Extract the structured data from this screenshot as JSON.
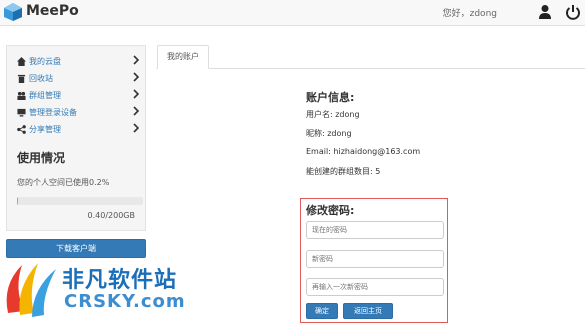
{
  "header": {
    "brand": "MeePo",
    "greeting": "您好，zdong"
  },
  "sidebar": {
    "items": [
      {
        "label": "我的云盘",
        "icon": "home-icon"
      },
      {
        "label": "回收站",
        "icon": "trash-icon"
      },
      {
        "label": "群组管理",
        "icon": "group-icon"
      },
      {
        "label": "管理登录设备",
        "icon": "monitor-icon"
      },
      {
        "label": "分享管理",
        "icon": "share-icon"
      }
    ],
    "usage": {
      "title": "使用情况",
      "text": "您的个人空间已使用0.2%",
      "percent": 0.2,
      "amount": "0.40/200GB"
    },
    "download_label": "下载客户端"
  },
  "main": {
    "tab_label": "我的账户",
    "account": {
      "title": "账户信息:",
      "username": "用户名: zdong",
      "nickname": "昵称: zdong",
      "email": "Email:  hizhaidong@163.com",
      "groups": "能创建的群组数目:  5"
    },
    "password": {
      "title": "修改密码:",
      "current_placeholder": "现在的密码",
      "new_placeholder": "新密码",
      "confirm_placeholder": "再输入一次新密码",
      "confirm_label": "确定",
      "back_label": "返回主页"
    }
  },
  "watermark": {
    "cn": "非凡软件站",
    "en": "CRSKY.com"
  },
  "colors": {
    "primary": "#337ab7",
    "highlight_border": "#e05a5a",
    "progress": "#5bc0de"
  }
}
